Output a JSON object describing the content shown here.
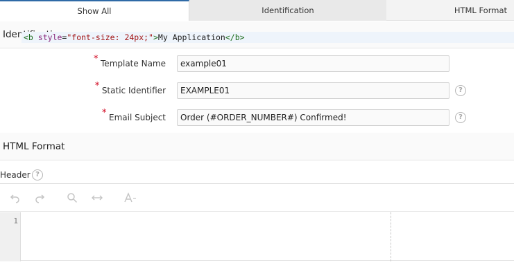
{
  "tabs": [
    {
      "label": "Show All",
      "active": true
    },
    {
      "label": "Identification",
      "active": false
    },
    {
      "label": "HTML Format",
      "active": false
    }
  ],
  "sections": {
    "identification": "Identification",
    "html_format": "HTML Format"
  },
  "fields": {
    "template_name": {
      "label": "Template Name",
      "required": true,
      "value": "example01"
    },
    "static_identifier": {
      "label": "Static Identifier",
      "required": true,
      "value": "EXAMPLE01"
    },
    "email_subject": {
      "label": "Email Subject",
      "required": true,
      "value": "Order (#ORDER_NUMBER#) Confirmed!"
    }
  },
  "header": {
    "label": "Header",
    "toolbar": [
      "undo-icon",
      "redo-icon",
      "search-icon",
      "replace-icon",
      "text-size-icon"
    ],
    "code": {
      "line_number": "1",
      "open_tag": "<b",
      "attr_name": "style",
      "equals": "=",
      "attr_value": "\"font-size: 24px;\"",
      "close_bracket": ">",
      "text": "My Application",
      "end_tag": "</b>"
    }
  },
  "colors": {
    "accent": "#2f6aa6",
    "required": "#d0021b",
    "tag": "#1a6b1a",
    "attr": "#8a2a7b",
    "string": "#a31515"
  }
}
